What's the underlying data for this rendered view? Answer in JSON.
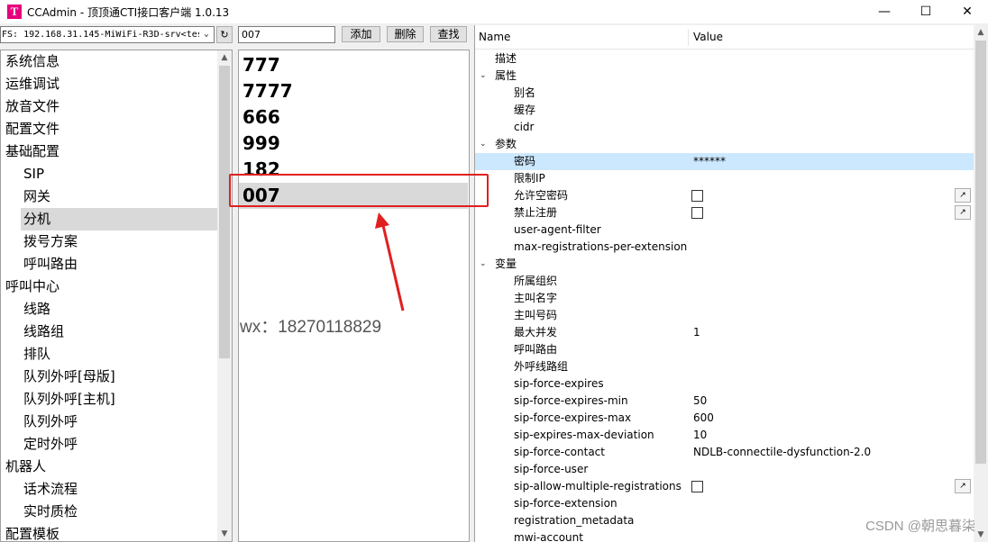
{
  "window": {
    "title": "CCAdmin - 顶顶通CTI接口客户端 1.0.13",
    "icon_letter": "T",
    "controls": [
      "—",
      "☐",
      "✕"
    ]
  },
  "toolbar": {
    "fs_value": "FS: 192.168.31.145-MiWiFi-R3D-srv<tes",
    "refresh_icon": "↻",
    "search_value": "007",
    "add_label": "添加",
    "delete_label": "删除",
    "find_label": "查找"
  },
  "tree": {
    "items": [
      {
        "label": "系统信息",
        "level": 0
      },
      {
        "label": "运维调试",
        "level": 0
      },
      {
        "label": "放音文件",
        "level": 0
      },
      {
        "label": "配置文件",
        "level": 0
      },
      {
        "label": "基础配置",
        "level": 0
      },
      {
        "label": "SIP",
        "level": 1
      },
      {
        "label": "网关",
        "level": 1
      },
      {
        "label": "分机",
        "level": 1,
        "selected": true
      },
      {
        "label": "拨号方案",
        "level": 1
      },
      {
        "label": "呼叫路由",
        "level": 1
      },
      {
        "label": "呼叫中心",
        "level": 0
      },
      {
        "label": "线路",
        "level": 1
      },
      {
        "label": "线路组",
        "level": 1
      },
      {
        "label": "排队",
        "level": 1
      },
      {
        "label": "队列外呼[母版]",
        "level": 1
      },
      {
        "label": "队列外呼[主机]",
        "level": 1
      },
      {
        "label": "队列外呼",
        "level": 1
      },
      {
        "label": "定时外呼",
        "level": 1
      },
      {
        "label": "机器人",
        "level": 0
      },
      {
        "label": "话术流程",
        "level": 1
      },
      {
        "label": "实时质检",
        "level": 1
      },
      {
        "label": "配置模板",
        "level": 0
      }
    ]
  },
  "extensions": {
    "items": [
      "777",
      "7777",
      "666",
      "999",
      "182",
      "007"
    ],
    "selected_index": 5
  },
  "annotation": {
    "wx_text": "wx：18270118829",
    "color": "#e02020"
  },
  "grid": {
    "col_name": "Name",
    "col_value": "Value",
    "rows": [
      {
        "name": "描述",
        "indent": 1
      },
      {
        "name": "属性",
        "indent": 0,
        "expander": "⌄"
      },
      {
        "name": "别名",
        "indent": 2
      },
      {
        "name": "缓存",
        "indent": 2
      },
      {
        "name": "cidr",
        "indent": 2
      },
      {
        "name": "参数",
        "indent": 0,
        "expander": "⌄"
      },
      {
        "name": "密码",
        "indent": 2,
        "value": "******",
        "selected": true
      },
      {
        "name": "限制IP",
        "indent": 2
      },
      {
        "name": "允许空密码",
        "indent": 2,
        "checkbox": true,
        "button": true
      },
      {
        "name": "禁止注册",
        "indent": 2,
        "checkbox": true,
        "button": true
      },
      {
        "name": "user-agent-filter",
        "indent": 2
      },
      {
        "name": "max-registrations-per-extension",
        "indent": 2
      },
      {
        "name": "变量",
        "indent": 0,
        "expander": "⌄"
      },
      {
        "name": "所属组织",
        "indent": 2
      },
      {
        "name": "主叫名字",
        "indent": 2
      },
      {
        "name": "主叫号码",
        "indent": 2
      },
      {
        "name": "最大并发",
        "indent": 2,
        "value": "1"
      },
      {
        "name": "呼叫路由",
        "indent": 2
      },
      {
        "name": "外呼线路组",
        "indent": 2
      },
      {
        "name": "sip-force-expires",
        "indent": 2
      },
      {
        "name": "sip-force-expires-min",
        "indent": 2,
        "value": "50"
      },
      {
        "name": "sip-force-expires-max",
        "indent": 2,
        "value": "600"
      },
      {
        "name": "sip-expires-max-deviation",
        "indent": 2,
        "value": "10"
      },
      {
        "name": "sip-force-contact",
        "indent": 2,
        "value": "NDLB-connectile-dysfunction-2.0"
      },
      {
        "name": "sip-force-user",
        "indent": 2
      },
      {
        "name": "sip-allow-multiple-registrations",
        "indent": 2,
        "checkbox": true,
        "button": true
      },
      {
        "name": "sip-force-extension",
        "indent": 2
      },
      {
        "name": "registration_metadata",
        "indent": 2
      },
      {
        "name": "mwi-account",
        "indent": 2
      }
    ],
    "mini_button_icon": "↗"
  },
  "watermark": "CSDN @朝思暮柒"
}
